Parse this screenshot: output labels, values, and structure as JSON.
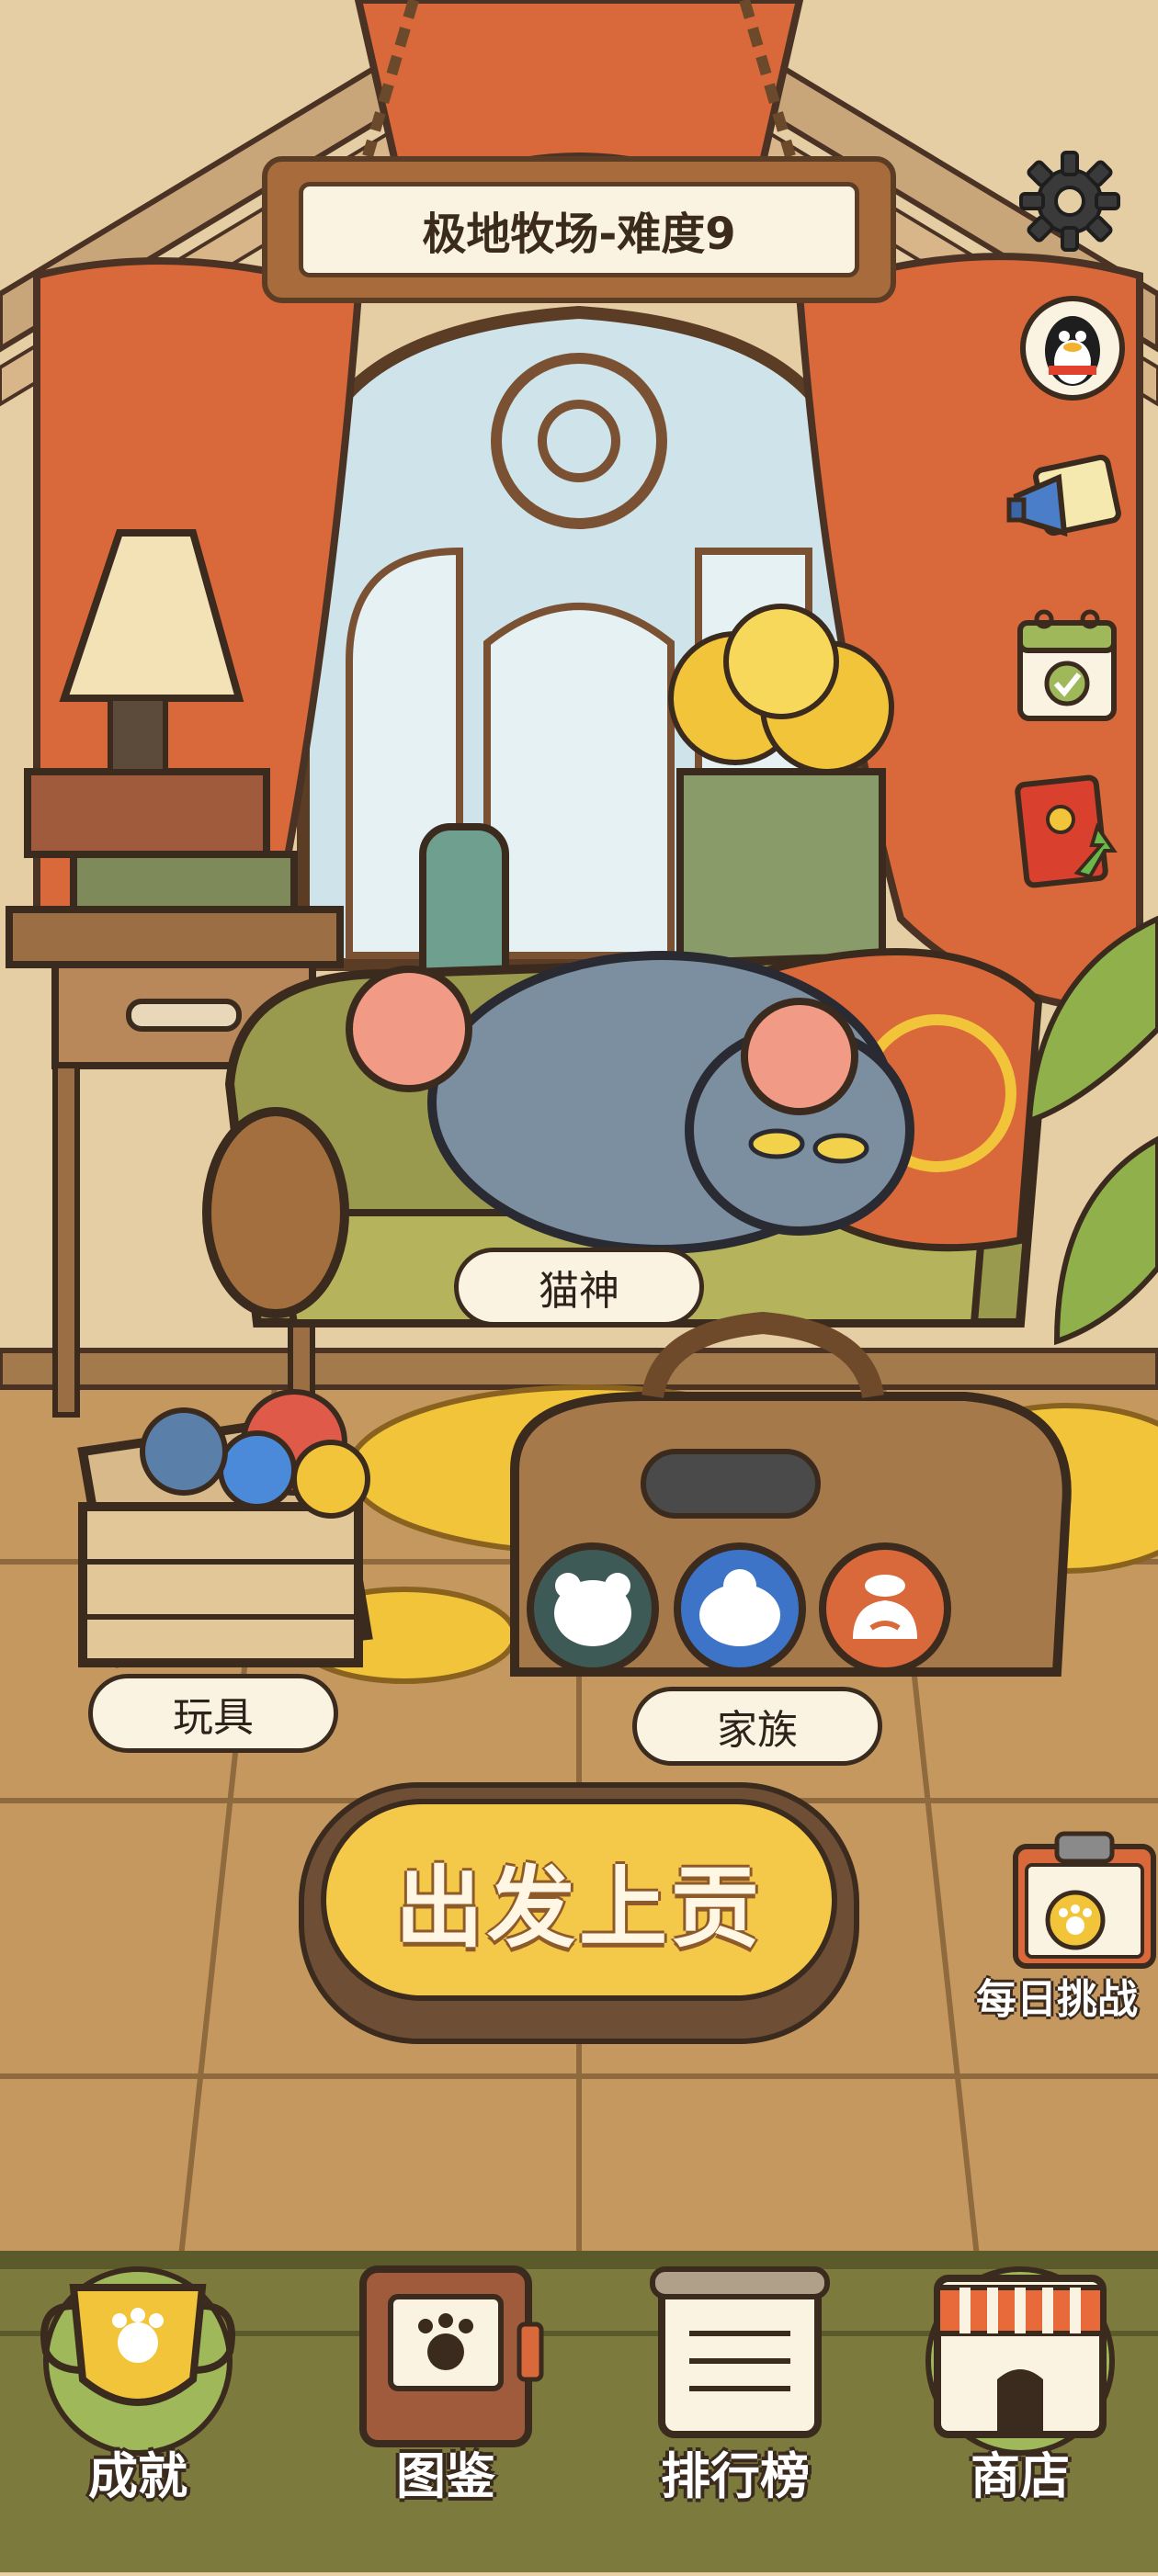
{
  "level": {
    "title": "极地牧场-难度9"
  },
  "scene": {
    "cat_label": "猫神",
    "toys_label": "玩具",
    "family_label": "家族"
  },
  "actions": {
    "start_button": "出发上贡",
    "daily_challenge": "每日挑战"
  },
  "side_icons": [
    "gear-icon",
    "qq-penguin-icon",
    "announcement-icon",
    "calendar-checkin-icon",
    "red-packet-icon"
  ],
  "nav": {
    "items": [
      {
        "label": "成就",
        "icon": "trophy-icon"
      },
      {
        "label": "图鉴",
        "icon": "paw-book-icon"
      },
      {
        "label": "排行榜",
        "icon": "scroll-icon"
      },
      {
        "label": "商店",
        "icon": "shop-icon"
      }
    ]
  },
  "colors": {
    "accent_yellow": "#f4c94a",
    "curtain_orange": "#d9683a",
    "outline": "#3b2a1e",
    "cream": "#fbf3e2"
  }
}
